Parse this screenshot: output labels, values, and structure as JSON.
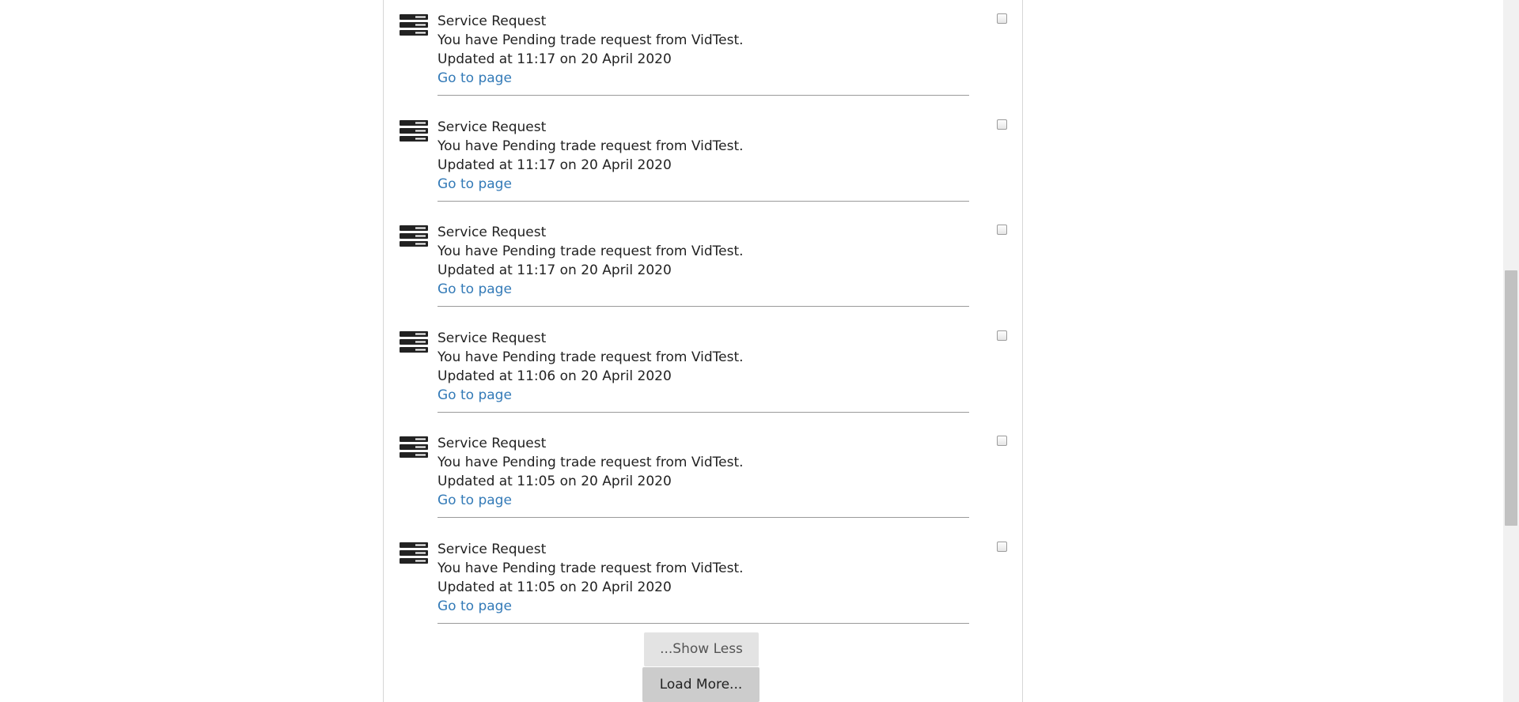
{
  "notifications": [
    {
      "title": "Service Request",
      "text": "You have Pending trade request from VidTest.",
      "updated": "Updated at 11:17 on 20 April 2020",
      "link": "Go to page",
      "icon": "server-icon"
    },
    {
      "title": "Service Request",
      "text": "You have Pending trade request from VidTest.",
      "updated": "Updated at 11:17 on 20 April 2020",
      "link": "Go to page",
      "icon": "server-icon"
    },
    {
      "title": "Service Request",
      "text": "You have Pending trade request from VidTest.",
      "updated": "Updated at 11:17 on 20 April 2020",
      "link": "Go to page",
      "icon": "server-icon"
    },
    {
      "title": "Service Request",
      "text": "You have Pending trade request from VidTest.",
      "updated": "Updated at 11:06 on 20 April 2020",
      "link": "Go to page",
      "icon": "server-icon"
    },
    {
      "title": "Service Request",
      "text": "You have Pending trade request from VidTest.",
      "updated": "Updated at 11:05 on 20 April 2020",
      "link": "Go to page",
      "icon": "server-icon"
    },
    {
      "title": "Service Request",
      "text": "You have Pending trade request from VidTest.",
      "updated": "Updated at 11:05 on 20 April 2020",
      "link": "Go to page",
      "icon": "server-icon"
    }
  ],
  "buttons": {
    "show_less": "...Show Less",
    "load_more": "Load More..."
  },
  "colors": {
    "link": "#337ab7",
    "divider": "#9a9a9a",
    "show_less_bg": "#e3e3e3",
    "load_more_bg": "#cccccc"
  }
}
